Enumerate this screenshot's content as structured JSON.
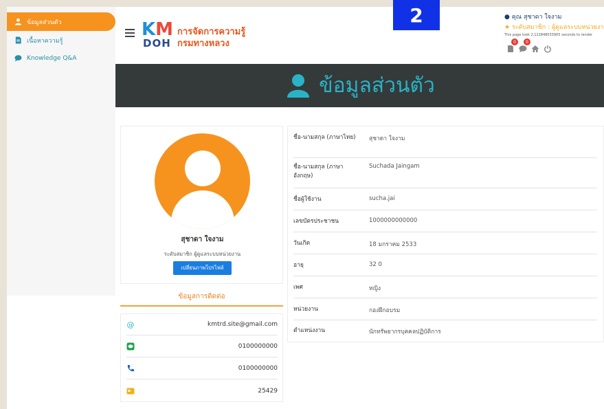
{
  "sidebar": {
    "items": [
      {
        "label": "ข้อมูลส่วนตัว",
        "icon": "user-icon",
        "active": true
      },
      {
        "label": "เนื้อหาความรู้",
        "icon": "document-icon",
        "active": false
      },
      {
        "label": "Knowledge Q&A",
        "icon": "chat-icon",
        "active": false
      }
    ]
  },
  "header": {
    "logo_km": "KM",
    "logo_doh": "DOH",
    "logo_line1": "การจัดการความรู้",
    "logo_line2": "กรมทางหลวง",
    "marker_number": "2",
    "user_name": "คุณ สุชาดา ใจงาม",
    "user_level": "ระดับสมาชิก : ผู้ดูแลระบบหน่วยงาน",
    "render_time": "This page took 2.122848033905 seconds to render",
    "notif_count_1": "0",
    "notif_count_2": "0"
  },
  "banner": {
    "title": "ข้อมูลส่วนตัว"
  },
  "profile": {
    "name": "สุชาดา ใจงาม",
    "role": "ระดับสมาชิก ผู้ดูแลระบบหน่วยงาน",
    "change_photo_button": "เปลี่ยนภาพโปรไฟล์"
  },
  "contact": {
    "title": "ข้อมูลการติดต่อ",
    "rows": [
      {
        "icon": "at-icon",
        "value": "kmtrd.site@gmail.com"
      },
      {
        "icon": "line-icon",
        "value": "0100000000"
      },
      {
        "icon": "phone-icon",
        "value": "0100000000"
      },
      {
        "icon": "contact-card-icon",
        "value": "25429"
      }
    ]
  },
  "info": {
    "rows": [
      {
        "label": "ชื่อ-นามสกุล (ภาษาไทย)",
        "value": "สุชาดา ใจงาม"
      },
      {
        "label": "ชื่อ-นามสกุล (ภาษาอังกฤษ)",
        "value": "Suchada Jaingam"
      },
      {
        "label": "ชื่อผู้ใช้งาน",
        "value": "sucha.jai"
      },
      {
        "label": "เลขบัตรประชาชน",
        "value": "1000000000000"
      },
      {
        "label": "วันเกิด",
        "value": "18 มกราคม 2533"
      },
      {
        "label": "อายุ",
        "value": "32 0"
      },
      {
        "label": "เพศ",
        "value": "หญิง"
      },
      {
        "label": "หน่วยงาน",
        "value": "กองฝึกอบรม"
      },
      {
        "label": "ตำแหน่งงาน",
        "value": "นักทรัพยากรบุคคลปฏิบัติการ"
      }
    ]
  },
  "colors": {
    "accent_orange": "#f6921e",
    "teal": "#2ab3c6",
    "banner_bg": "#343a3a",
    "button_blue": "#1a7de0"
  }
}
